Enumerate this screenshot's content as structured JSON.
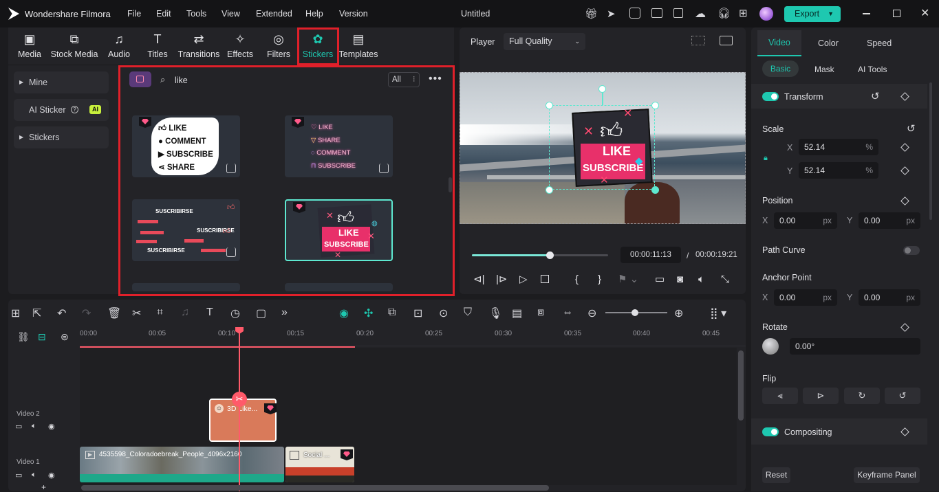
{
  "app": {
    "name": "Wondershare Filmora",
    "doc_title": "Untitled",
    "export_label": "Export"
  },
  "menu": [
    "File",
    "Edit",
    "Tools",
    "View",
    "Extended",
    "Help",
    "Version"
  ],
  "toolbar": [
    {
      "label": "Media",
      "icon": "media-icon"
    },
    {
      "label": "Stock Media",
      "icon": "stock-media-icon"
    },
    {
      "label": "Audio",
      "icon": "audio-icon"
    },
    {
      "label": "Titles",
      "icon": "titles-icon"
    },
    {
      "label": "Transitions",
      "icon": "transitions-icon"
    },
    {
      "label": "Effects",
      "icon": "effects-icon"
    },
    {
      "label": "Filters",
      "icon": "filters-icon"
    },
    {
      "label": "Stickers",
      "icon": "stickers-icon",
      "active": true
    },
    {
      "label": "Templates",
      "icon": "templates-icon"
    }
  ],
  "sidebar": {
    "mine": "Mine",
    "ai_sticker": "AI Sticker",
    "ai_badge": "AI",
    "stickers": "Stickers"
  },
  "search": {
    "query": "like",
    "filter_label": "All"
  },
  "stickers": [
    {
      "lines": [
        "LIKE",
        "COMMENT",
        "SUBSCRIBE",
        "SHARE"
      ]
    },
    {
      "lines": [
        "LIKE",
        "SHARE",
        "COMMENT",
        "SUBSCRIBE"
      ]
    },
    {
      "lines": [
        "SUSCRIBIRSE",
        "SUSCRIBIRSE",
        "SUSCRIBIRSE"
      ]
    },
    {
      "lines": [
        "LIKE",
        "SUBSCRIBE"
      ]
    }
  ],
  "player": {
    "label": "Player",
    "quality": "Full Quality",
    "current_time": "00:00:11:13",
    "separator": "/",
    "total_time": "00:00:19:21",
    "progress": 0.57,
    "overlay_like": "LIKE",
    "overlay_subscribe": "SUBSCRIBE"
  },
  "right_panel": {
    "tabs": [
      "Video",
      "Color",
      "Speed"
    ],
    "subtabs": [
      "Basic",
      "Mask",
      "AI Tools"
    ],
    "transform": "Transform",
    "scale": "Scale",
    "scale_x_label": "X",
    "scale_x": "52.14",
    "scale_y_label": "Y",
    "scale_y": "52.14",
    "percent": "%",
    "position": "Position",
    "pos_x_label": "X",
    "pos_x": "0.00",
    "pos_y_label": "Y",
    "pos_y": "0.00",
    "px": "px",
    "path_curve": "Path Curve",
    "anchor_point": "Anchor Point",
    "anc_x_label": "X",
    "anc_x": "0.00",
    "anc_y_label": "Y",
    "anc_y": "0.00",
    "rotate": "Rotate",
    "rotate_value": "0.00°",
    "flip": "Flip",
    "compositing": "Compositing",
    "reset": "Reset",
    "keyframe_panel": "Keyframe Panel"
  },
  "timeline": {
    "ruler": [
      "00:00",
      "00:05",
      "00:10",
      "00:15",
      "00:20",
      "00:25",
      "00:30",
      "00:35",
      "00:40",
      "00:45"
    ],
    "tracks": [
      {
        "name": "Video 2"
      },
      {
        "name": "Video 1"
      }
    ],
    "sticker_clip": "3D Like...",
    "video_clip": "4535598_Coloradoebreak_People_4096x2160",
    "social_clip": "Social ..."
  },
  "colors": {
    "accent": "#1ec8b0",
    "highlight": "#e0202a",
    "playhead": "#ff5a6a",
    "clip": "#d97a5a"
  }
}
